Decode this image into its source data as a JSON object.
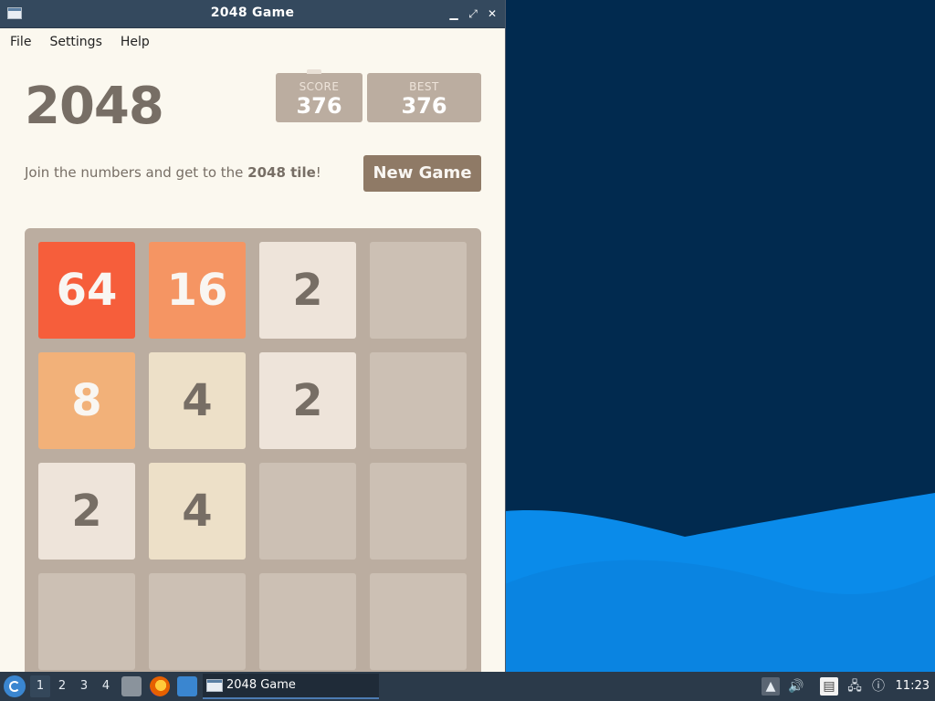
{
  "window": {
    "title": "2048 Game",
    "controls": [
      "minimize",
      "maximize",
      "close"
    ]
  },
  "menubar": [
    "File",
    "Settings",
    "Help"
  ],
  "game": {
    "title": "2048",
    "score_label": "SCORE",
    "score_value": "376",
    "best_label": "BEST",
    "best_value": "376",
    "intro_prefix": "Join the numbers and get to the ",
    "intro_bold": "2048 tile",
    "intro_suffix": "!",
    "new_game_label": "New Game",
    "board": [
      [
        "64",
        "16",
        "2",
        ""
      ],
      [
        "8",
        "4",
        "2",
        ""
      ],
      [
        "2",
        "4",
        "",
        ""
      ],
      [
        "",
        "",
        "",
        ""
      ]
    ]
  },
  "taskbar": {
    "workspaces": [
      "1",
      "2",
      "3",
      "4"
    ],
    "active_workspace": "1",
    "task_label": "2048 Game",
    "clock": "11:23"
  },
  "colors": {
    "titlebar": "#34495e",
    "board": "#bbada0",
    "tile_2": "#eee4da",
    "tile_4": "#ede0c8",
    "tile_8": "#f2b179",
    "tile_16": "#f59563",
    "tile_64": "#f65e3b",
    "wallpaper_dark": "#012a4f",
    "wallpaper_wave": "#0a8bea"
  }
}
